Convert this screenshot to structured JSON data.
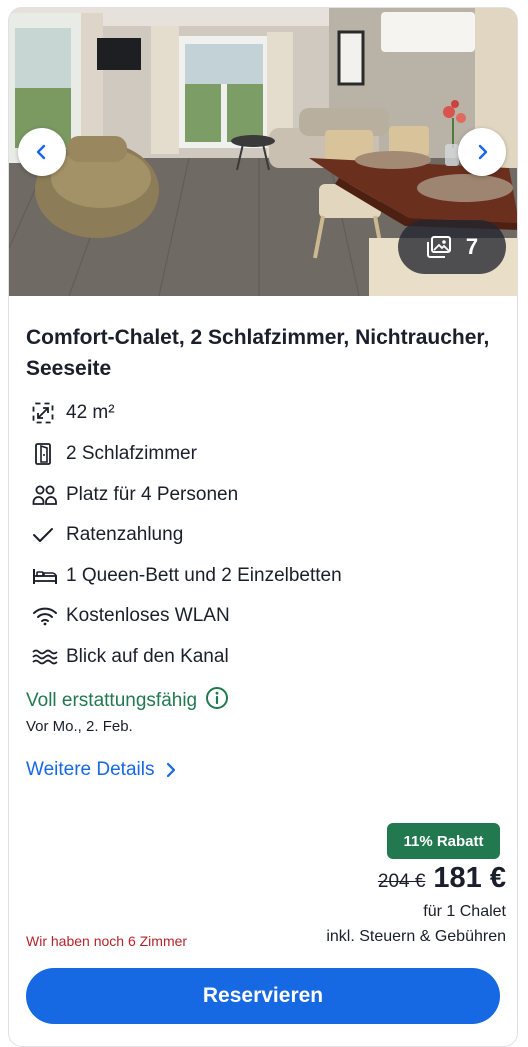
{
  "gallery": {
    "photo_count": "7"
  },
  "listing": {
    "title": "Comfort-Chalet, 2 Schlafzimmer, Nichtraucher, Seeseite",
    "amenities": [
      {
        "icon": "area-icon",
        "label": "42 m²"
      },
      {
        "icon": "door-icon",
        "label": "2 Schlafzimmer"
      },
      {
        "icon": "people-icon",
        "label": "Platz für 4 Personen"
      },
      {
        "icon": "check-icon",
        "label": "Ratenzahlung"
      },
      {
        "icon": "bed-icon",
        "label": "1 Queen-Bett und 2 Einzelbetten"
      },
      {
        "icon": "wifi-icon",
        "label": "Kostenloses WLAN"
      },
      {
        "icon": "waves-icon",
        "label": "Blick auf den Kanal"
      }
    ],
    "refund_label": "Voll erstattungsfähig",
    "refund_deadline": "Vor Mo., 2. Feb.",
    "details_link": "Weitere Details"
  },
  "pricing": {
    "discount_badge": "11% Rabatt",
    "old_price": "204 €",
    "new_price": "181 €",
    "per_unit": "für 1 Chalet",
    "taxes_note": "inkl. Steuern & Gebühren",
    "rooms_left": "Wir haben noch 6 Zimmer"
  },
  "actions": {
    "reserve_label": "Reservieren"
  },
  "colors": {
    "accent_blue": "#1668e3",
    "success_green": "#227950",
    "alert_red": "#b3252b",
    "text_dark": "#1b1f2b"
  }
}
